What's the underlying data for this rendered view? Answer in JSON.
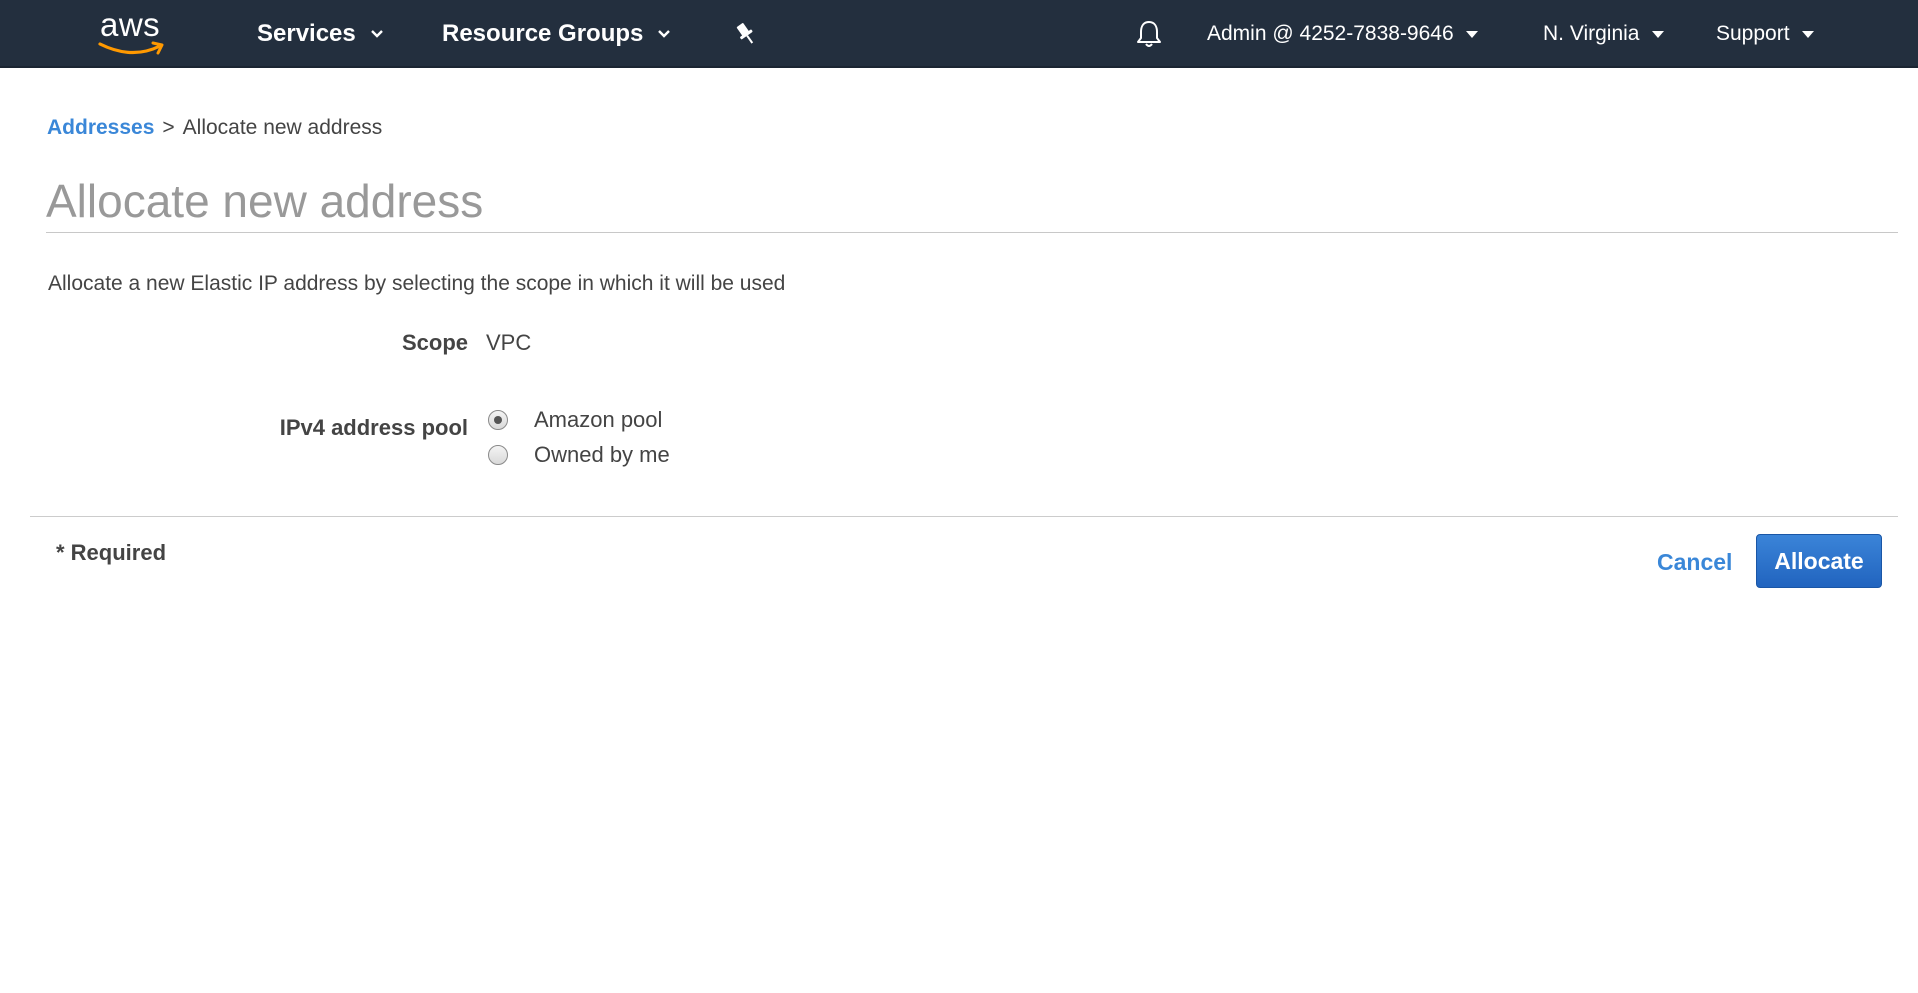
{
  "colors": {
    "nav_background": "#232f3e",
    "link": "#3a87d8",
    "primary_button": "#2a6fca",
    "aws_smile": "#ff9900"
  },
  "nav": {
    "logo_text": "aws",
    "services_label": "Services",
    "resource_groups_label": "Resource Groups",
    "pin_icon": "pushpin-icon",
    "bell_icon": "bell-icon",
    "account_label": "Admin @ 4252-7838-9646",
    "region_label": "N. Virginia",
    "support_label": "Support"
  },
  "breadcrumb": {
    "parent_label": "Addresses",
    "separator": ">",
    "current_label": "Allocate new address"
  },
  "page": {
    "title": "Allocate new address",
    "description": "Allocate a new Elastic IP address by selecting the scope in which it will be used"
  },
  "form": {
    "scope_label": "Scope",
    "scope_value": "VPC",
    "pool_label": "IPv4 address pool",
    "pool_options": [
      {
        "label": "Amazon pool",
        "selected": true
      },
      {
        "label": "Owned by me",
        "selected": false
      }
    ]
  },
  "footer": {
    "required_note": "* Required",
    "cancel_label": "Cancel",
    "allocate_label": "Allocate"
  }
}
